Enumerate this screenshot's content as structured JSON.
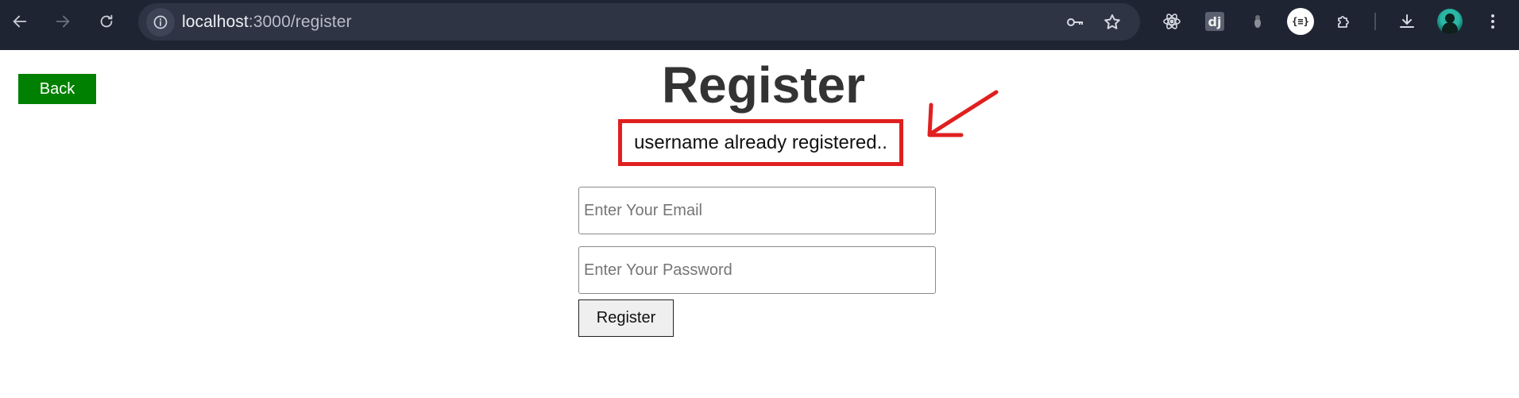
{
  "browser": {
    "url_host": "localhost",
    "url_path": ":3000/register",
    "icons": {
      "back": "arrow-left-icon",
      "forward": "arrow-right-icon",
      "reload": "reload-icon",
      "site_info": "info-icon",
      "password_key": "key-icon",
      "bookmark": "star-icon",
      "react_devtools": "react-icon",
      "django": "django-icon",
      "extension_gray": "extension-icon",
      "json_viewer": "json-icon",
      "extensions": "puzzle-icon",
      "downloads": "download-icon",
      "profile": "avatar",
      "menu": "more-vertical-icon"
    },
    "django_label": "dj",
    "json_label": "{≡}"
  },
  "page": {
    "back_label": "Back",
    "title": "Register",
    "error_message": "username already registered..",
    "email_placeholder": "Enter Your Email",
    "password_placeholder": "Enter Your Password",
    "submit_label": "Register"
  },
  "colors": {
    "toolbar_bg": "#1f2433",
    "back_button_bg": "#008000",
    "error_border": "#e02020",
    "annotation_arrow": "#e02020",
    "title_text": "#333333"
  }
}
